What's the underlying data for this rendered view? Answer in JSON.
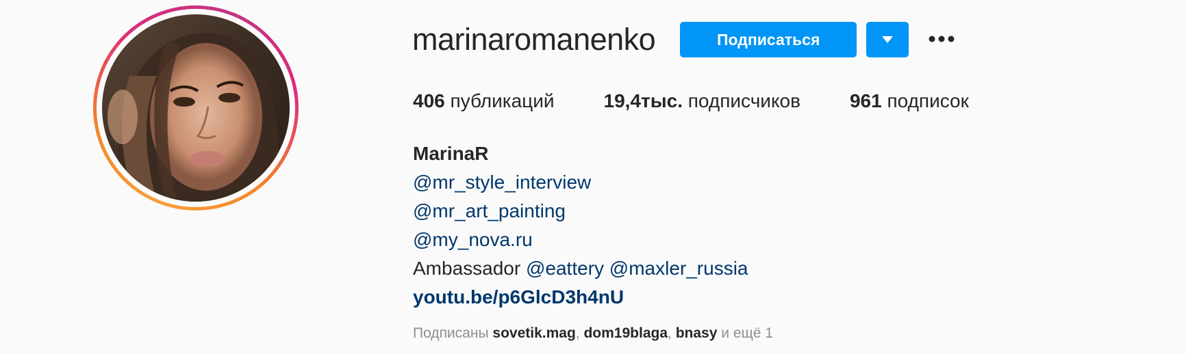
{
  "profile": {
    "username": "marinaromanenko",
    "follow_label": "Подписаться"
  },
  "stats": {
    "posts": {
      "value": "406",
      "label": "публикаций"
    },
    "followers": {
      "value": "19,4тыс.",
      "label": "подписчиков"
    },
    "following": {
      "value": "961",
      "label": "подписок"
    }
  },
  "bio": {
    "name": "MarinaR",
    "links": [
      "@mr_style_interview",
      "@mr_art_painting",
      "@my_nova.ru"
    ],
    "ambassador_text": "Ambassador",
    "ambassador_links": [
      "@eattery",
      "@maxler_russia"
    ],
    "url": "youtu.be/p6GlcD3h4nU"
  },
  "followed_by": {
    "prefix": "Подписаны",
    "accounts": [
      "sovetik.mag",
      "dom19blaga",
      "bnasy"
    ],
    "sep": ",",
    "suffix": "и ещё 1"
  },
  "icons": {
    "dropdown": "caret-down-icon",
    "more": "more-options-icon"
  },
  "colors": {
    "accent": "#0095f6",
    "link": "#00376b",
    "muted": "#8e8e8e"
  }
}
